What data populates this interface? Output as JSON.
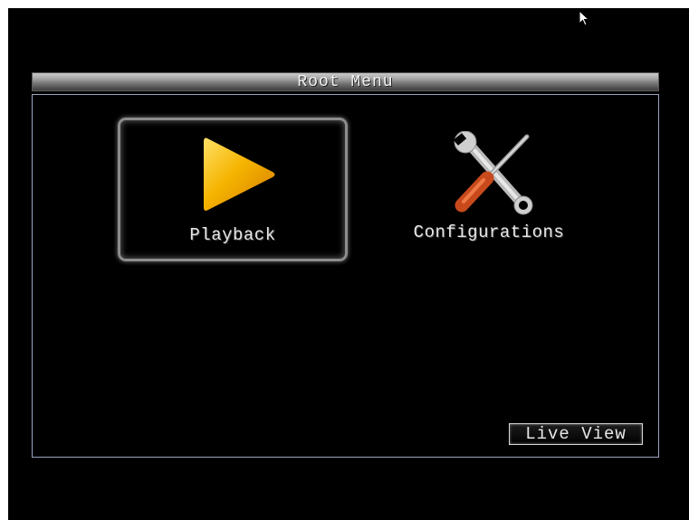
{
  "menu": {
    "title": "Root Menu",
    "items": [
      {
        "label": "Playback",
        "icon": "play-icon",
        "selected": true
      },
      {
        "label": "Configurations",
        "icon": "wrench-screwdriver-icon",
        "selected": false
      }
    ]
  },
  "footer": {
    "live_view_label": "Live View"
  },
  "colors": {
    "background": "#000000",
    "frame_border": "#9aa4c4",
    "play_icon": "#f5b400",
    "text": "#e6e6e6"
  }
}
